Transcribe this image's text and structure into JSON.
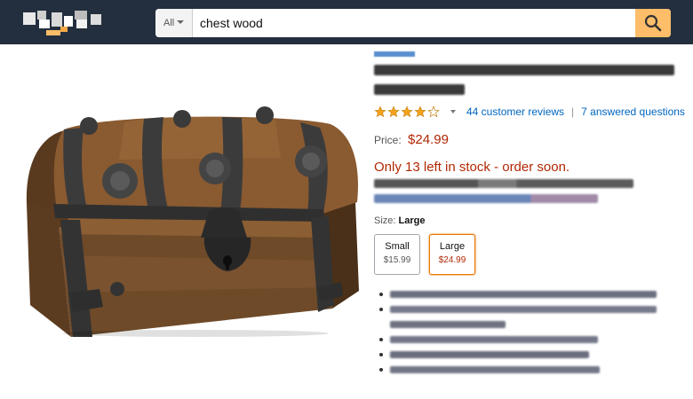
{
  "header": {
    "search": {
      "category": "All",
      "query": "chest wood"
    }
  },
  "colors": {
    "header_bg": "#232f3e",
    "search_button": "#febd69",
    "link": "#0066c0",
    "price": "#b12704",
    "star": "#f4a41d",
    "selected_border": "#e77600"
  },
  "icons": {
    "logo": "blurred-logo",
    "search": "search-icon",
    "star": "star-icon"
  },
  "product": {
    "rating": {
      "stars": 4,
      "reviews_text": "44 customer reviews",
      "separator": "|",
      "questions_text": "7 answered questions"
    },
    "price": {
      "label": "Price:",
      "amount": "$24.99"
    },
    "stock_text": "Only 13 left in stock - order soon.",
    "size": {
      "label": "Size:",
      "selected": "Large",
      "options": [
        {
          "name": "Small",
          "price": "$15.99"
        },
        {
          "name": "Large",
          "price": "$24.99"
        }
      ]
    }
  }
}
